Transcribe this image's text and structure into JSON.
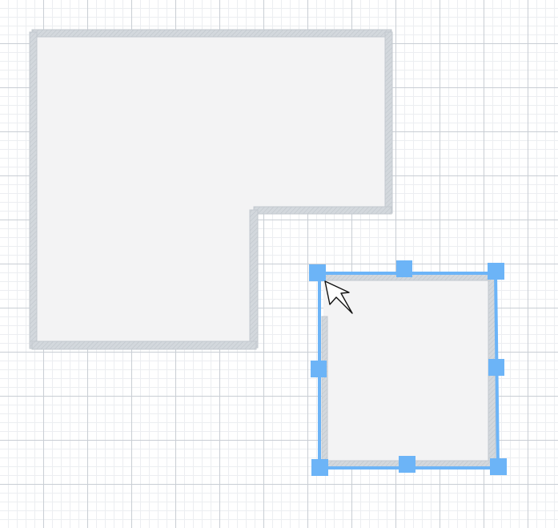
{
  "canvas": {
    "grid": "on",
    "background_color": "#ffffff",
    "minor_grid_color": "#eceef1",
    "major_grid_color": "#c9ced4"
  },
  "rooms": [
    {
      "name": "l-shaped-room",
      "selected": false,
      "floor_color": "#f3f3f4",
      "wall_color": "#d3d8dd"
    },
    {
      "name": "square-room",
      "selected": true,
      "floor_color": "#f3f3f4",
      "wall_color": "#d3d8dd",
      "selection_color": "#6cb4f7"
    }
  ],
  "cursor": {
    "icon": "move-arrow-cursor"
  }
}
